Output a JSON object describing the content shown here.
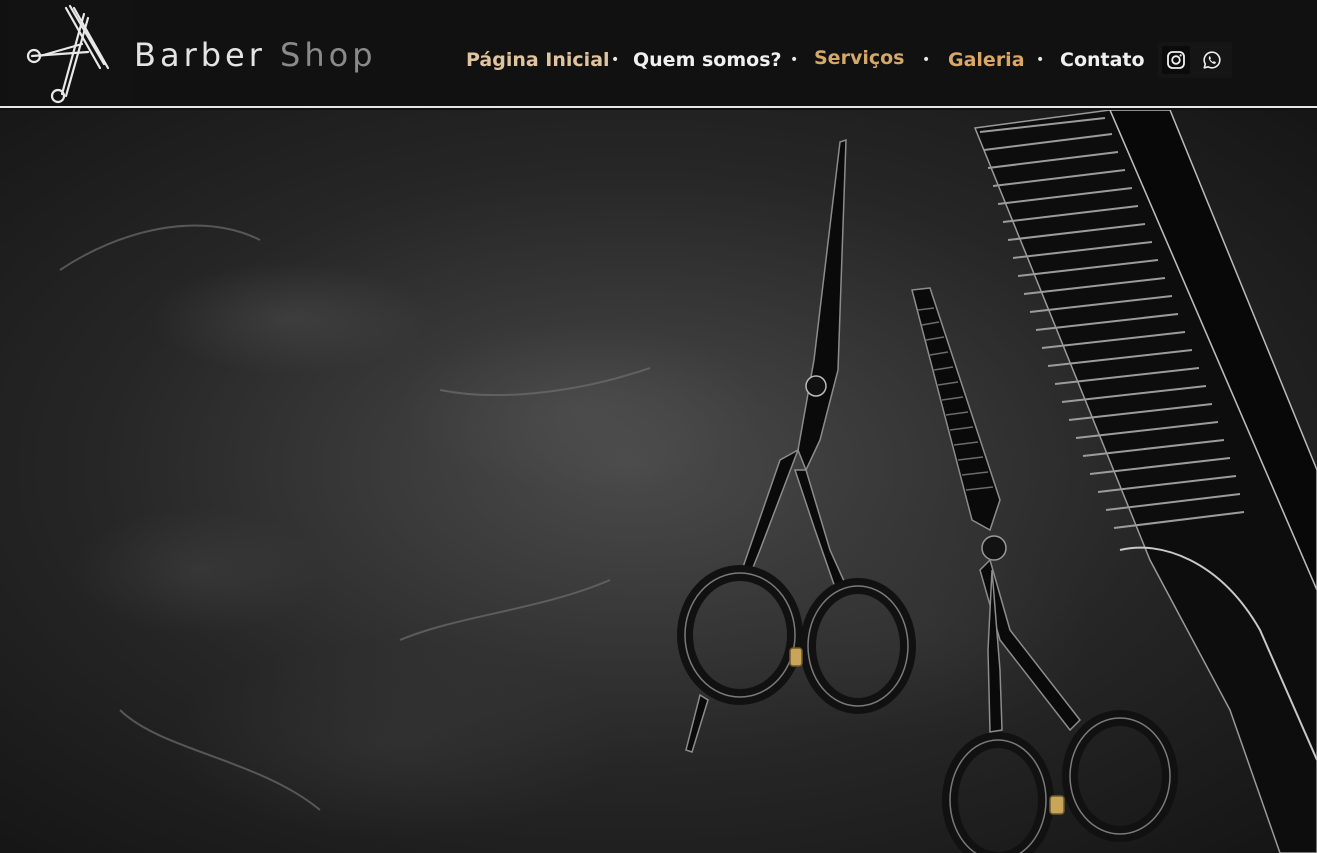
{
  "brand": {
    "word1": "Barber",
    "word2": "Shop"
  },
  "nav": {
    "items": [
      {
        "label": "Página Inicial",
        "color": "#e0c4a0"
      },
      {
        "label": "Quem somos?",
        "color": "#f0f0f0"
      },
      {
        "label": "Serviços",
        "color": "#d4a86a"
      },
      {
        "label": "Galeria",
        "color": "#d9a768"
      },
      {
        "label": "Contato",
        "color": "#f0f0f0"
      }
    ],
    "separator": "•"
  },
  "social": {
    "icons": [
      "instagram-icon",
      "whatsapp-icon"
    ]
  },
  "colors": {
    "header_bg": "#111111",
    "accent_gold": "#d4a86a",
    "divider": "#e6e6e6"
  }
}
